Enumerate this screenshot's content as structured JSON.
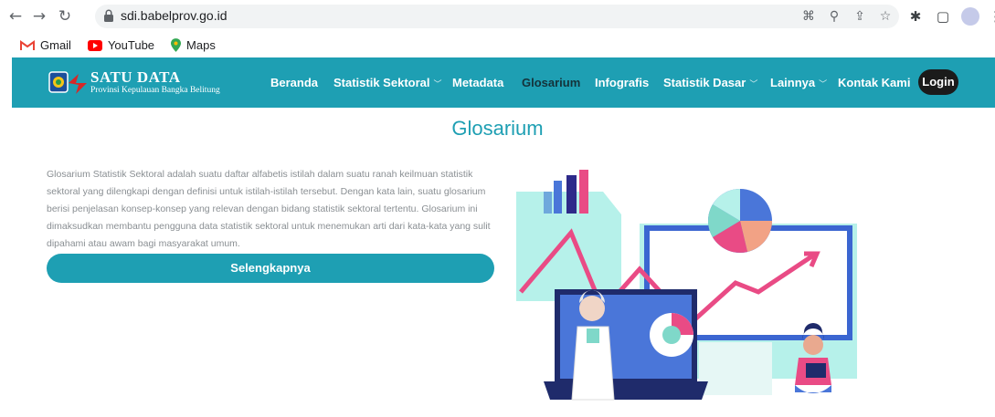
{
  "browser": {
    "url": "sdi.babelprov.go.id",
    "bookmarks": [
      {
        "label": "Gmail",
        "icon": "gmail-icon"
      },
      {
        "label": "YouTube",
        "icon": "youtube-icon"
      },
      {
        "label": "Maps",
        "icon": "maps-icon"
      }
    ]
  },
  "site": {
    "logo_title": "SATU DATA",
    "logo_subtitle": "Provinsi Kepulauan Bangka Belitung",
    "nav": [
      {
        "label": "Beranda",
        "dropdown": false,
        "active": false
      },
      {
        "label": "Statistik Sektoral",
        "dropdown": true,
        "active": false
      },
      {
        "label": "Metadata",
        "dropdown": false,
        "active": false
      },
      {
        "label": "Glosarium",
        "dropdown": false,
        "active": true
      },
      {
        "label": "Infografis",
        "dropdown": false,
        "active": false
      },
      {
        "label": "Statistik Dasar",
        "dropdown": true,
        "active": false
      },
      {
        "label": "Lainnya",
        "dropdown": true,
        "active": false
      },
      {
        "label": "Kontak Kami",
        "dropdown": false,
        "active": false
      }
    ],
    "login_label": "Login",
    "accent": "#1e9fb3"
  },
  "main": {
    "title": "Glosarium",
    "description": "Glosarium Statistik Sektoral adalah suatu daftar alfabetis istilah dalam suatu ranah keilmuan statistik sektoral yang dilengkapi dengan definisi untuk istilah-istilah tersebut. Dengan kata lain, suatu glosarium berisi penjelasan konsep-konsep yang relevan dengan bidang statistik sektoral tertentu. Glosarium ini dimaksudkan membantu pengguna data statistik sektoral untuk menemukan arti dari kata-kata yang sulit dipahami atau awam bagi masyarakat umum.",
    "cta_label": "Selengkapnya"
  }
}
